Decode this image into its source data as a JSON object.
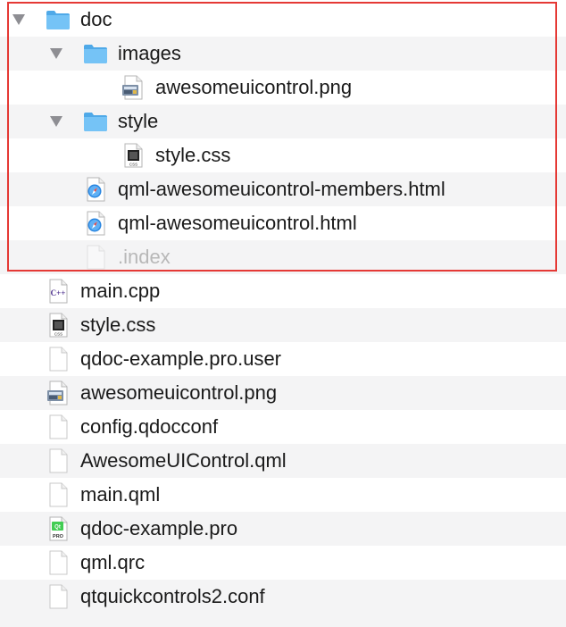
{
  "items": [
    {
      "name": "doc",
      "icon": "folder-icon",
      "level": 0,
      "expanded": true,
      "dim": false
    },
    {
      "name": "images",
      "icon": "folder-icon",
      "level": 1,
      "expanded": true,
      "dim": false
    },
    {
      "name": "awesomeuicontrol.png",
      "icon": "png-file-icon",
      "level": 2,
      "dim": false
    },
    {
      "name": "style",
      "icon": "folder-icon",
      "level": 1,
      "expanded": true,
      "dim": false
    },
    {
      "name": "style.css",
      "icon": "css-file-icon",
      "level": 2,
      "dim": false
    },
    {
      "name": "qml-awesomeuicontrol-members.html",
      "icon": "html-file-icon",
      "level": 1,
      "dim": false
    },
    {
      "name": "qml-awesomeuicontrol.html",
      "icon": "html-file-icon",
      "level": 1,
      "dim": false
    },
    {
      "name": ".index",
      "icon": "generic-file-icon",
      "level": 1,
      "dim": true
    },
    {
      "name": "main.cpp",
      "icon": "cpp-file-icon",
      "level": 0,
      "dim": false
    },
    {
      "name": "style.css",
      "icon": "css-file-icon",
      "level": 0,
      "dim": false
    },
    {
      "name": "qdoc-example.pro.user",
      "icon": "generic-file-icon",
      "level": 0,
      "dim": false
    },
    {
      "name": "awesomeuicontrol.png",
      "icon": "png-file-icon",
      "level": 0,
      "dim": false
    },
    {
      "name": "config.qdocconf",
      "icon": "generic-file-icon",
      "level": 0,
      "dim": false
    },
    {
      "name": "AwesomeUIControl.qml",
      "icon": "generic-file-icon",
      "level": 0,
      "dim": false
    },
    {
      "name": "main.qml",
      "icon": "generic-file-icon",
      "level": 0,
      "dim": false
    },
    {
      "name": "qdoc-example.pro",
      "icon": "pro-file-icon",
      "level": 0,
      "dim": false
    },
    {
      "name": "qml.qrc",
      "icon": "generic-file-icon",
      "level": 0,
      "dim": false
    },
    {
      "name": "qtquickcontrols2.conf",
      "icon": "generic-file-icon",
      "level": 0,
      "dim": false
    }
  ],
  "icon_labels": {
    "css": "CSS",
    "cpp": "C++",
    "pro": "PRO",
    "qt": "Qt"
  },
  "colors": {
    "selection_outline": "#e53935",
    "folder": "#5eb8f2",
    "alt_row": "#f4f4f5",
    "dim_text": "#b8b8b8"
  }
}
